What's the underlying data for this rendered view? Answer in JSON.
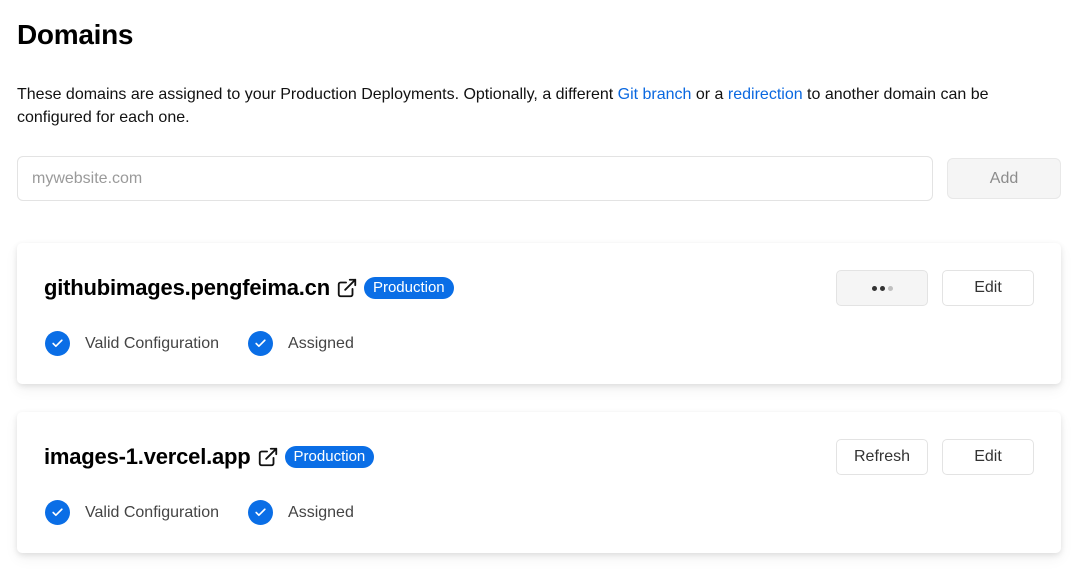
{
  "header": {
    "title": "Domains"
  },
  "description": {
    "text_before": "These domains are assigned to your Production Deployments. Optionally, a different ",
    "link_git_branch": "Git branch",
    "text_middle": " or a ",
    "link_redirection": "redirection",
    "text_after": " to another domain can be configured for each one."
  },
  "add_domain": {
    "placeholder": "mywebsite.com",
    "value": "",
    "button_label": "Add"
  },
  "domains": [
    {
      "name": "githubimages.pengfeima.cn",
      "badge": "Production",
      "primary_action": {
        "label": "",
        "state": "loading",
        "icon": "loading-dots-icon"
      },
      "edit_label": "Edit",
      "statuses": [
        {
          "label": "Valid Configuration",
          "icon": "check-circle-icon"
        },
        {
          "label": "Assigned",
          "icon": "check-circle-icon"
        }
      ]
    },
    {
      "name": "images-1.vercel.app",
      "badge": "Production",
      "primary_action": {
        "label": "Refresh",
        "state": "idle"
      },
      "edit_label": "Edit",
      "statuses": [
        {
          "label": "Valid Configuration",
          "icon": "check-circle-icon"
        },
        {
          "label": "Assigned",
          "icon": "check-circle-icon"
        }
      ]
    }
  ],
  "colors": {
    "accent": "#0a6ee6",
    "link": "#0a68e0",
    "border": "#e3e3e3"
  }
}
